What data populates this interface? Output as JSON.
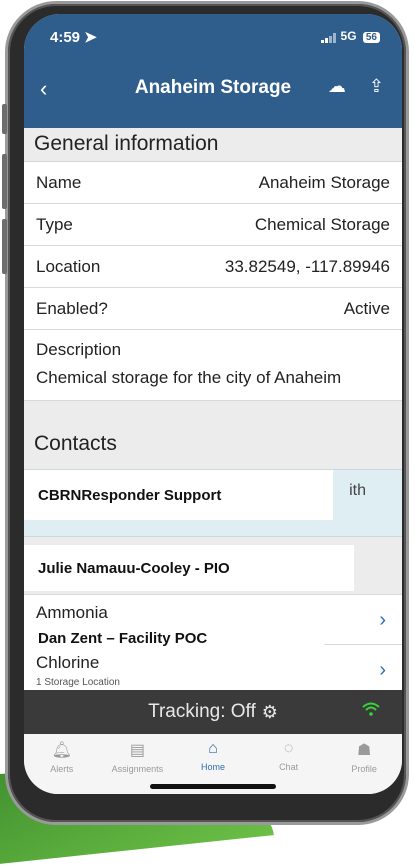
{
  "status": {
    "time": "4:59",
    "network": "5G",
    "battery": "56"
  },
  "nav": {
    "title": "Anaheim Storage",
    "back": "‹",
    "cloud_icon": "cloud-icon",
    "share_icon": "upload-icon"
  },
  "general": {
    "heading": "General information",
    "name_label": "Name",
    "name_value": "Anaheim Storage",
    "type_label": "Type",
    "type_value": "Chemical Storage",
    "location_label": "Location",
    "location_value": "33.82549, -117.89946",
    "enabled_label": "Enabled?",
    "enabled_value": "Active",
    "description_label": "Description",
    "description_value": "Chemical storage for the city of Anaheim"
  },
  "contacts": {
    "heading": "Contacts",
    "peek_text": "ith",
    "overlay_1": "CBRNResponder Support",
    "overlay_2": "Julie Namauu-Cooley - PIO",
    "overlay_3": "Dan Zent – Facility POC"
  },
  "chemicals": [
    {
      "name": "Ammonia",
      "sub": ""
    },
    {
      "name": "Chlorine",
      "sub": "1 Storage Location"
    }
  ],
  "tracking": {
    "label": "Tracking:",
    "value": "Off"
  },
  "tabs": [
    {
      "label": "Alerts",
      "icon": "bell-icon"
    },
    {
      "label": "Assignments",
      "icon": "clipboard-icon"
    },
    {
      "label": "Home",
      "icon": "home-icon"
    },
    {
      "label": "Chat",
      "icon": "chat-icon"
    },
    {
      "label": "Profile",
      "icon": "user-icon"
    }
  ],
  "colors": {
    "header": "#2f5d8c",
    "accent": "#2f6fb0",
    "tracking_bar": "#3a3a3a",
    "wifi": "#39d239"
  }
}
